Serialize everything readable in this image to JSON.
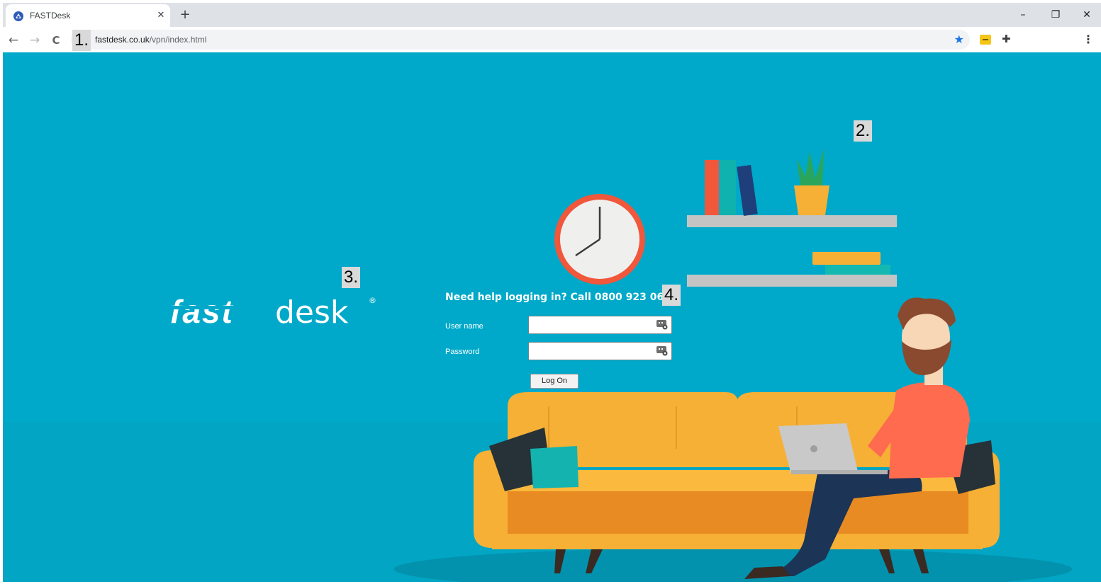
{
  "browser": {
    "tab_title": "FASTDesk",
    "tab_close": "✕",
    "new_tab": "+",
    "url_host": "fastdesk.co.uk",
    "url_path": "/vpn/index.html",
    "nav_back": "←",
    "nav_forward": "→",
    "nav_reload": "C",
    "star": "★",
    "extension_icon": "✚",
    "menu": "⋮",
    "minimize": "–",
    "restore": "❐",
    "close": "✕",
    "icons": [
      "tab-favicon-icon",
      "back-arrow-icon",
      "forward-arrow-icon",
      "reload-icon",
      "bookmark-star-icon",
      "extension-yellow-icon",
      "puzzle-piece-icon",
      "kebab-menu-icon"
    ]
  },
  "annotations": [
    "1.",
    "2.",
    "3.",
    "4."
  ],
  "login": {
    "help_text": "Need help logging in? Call 0800 923 0617",
    "username_label": "User name",
    "username_value": "",
    "password_label": "Password",
    "password_value": "",
    "logon_label": "Log On"
  },
  "logo": {
    "text_fast": "fast",
    "text_desk": "desk",
    "registered": "®"
  },
  "colors": {
    "background": "#00a9c9",
    "sofa": "#f6b035",
    "shirt": "#ff6b4f",
    "shelf": "#c4c4c4",
    "clock_rim": "#f0573b"
  }
}
